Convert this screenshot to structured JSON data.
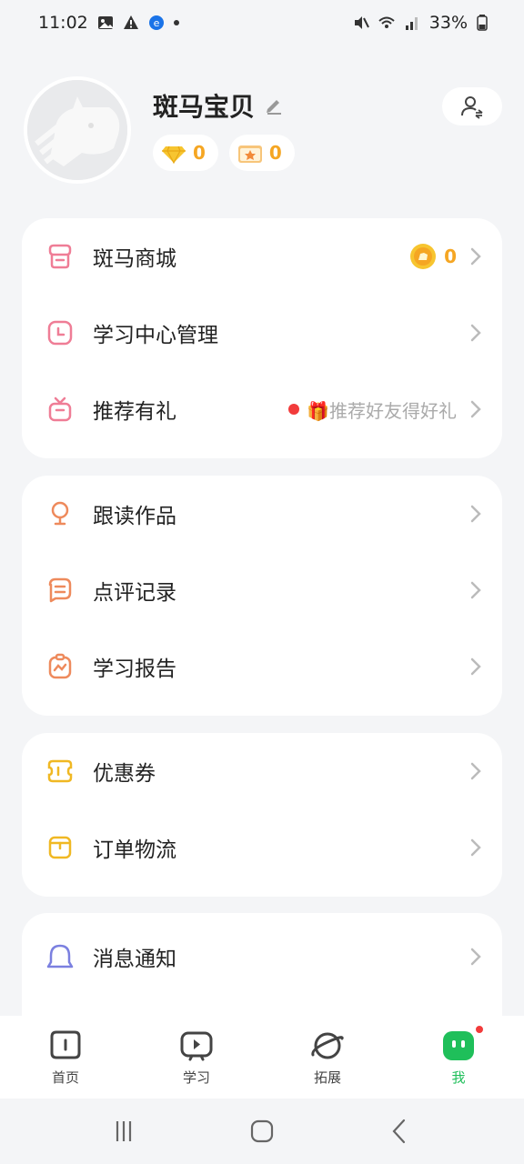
{
  "status_bar": {
    "time": "11:02",
    "battery": "33%"
  },
  "profile": {
    "username": "斑马宝贝",
    "diamonds": "0",
    "gift_count": "0"
  },
  "menu_groups": [
    {
      "items": [
        {
          "label": "斑马商城",
          "icon": "store-icon",
          "extra_count": "0"
        },
        {
          "label": "学习中心管理",
          "icon": "clock-icon"
        },
        {
          "label": "推荐有礼",
          "icon": "gift-box-icon",
          "extra_text": "🎁推荐好友得好礼"
        }
      ]
    },
    {
      "items": [
        {
          "label": "跟读作品",
          "icon": "microphone-icon"
        },
        {
          "label": "点评记录",
          "icon": "comment-icon"
        },
        {
          "label": "学习报告",
          "icon": "report-icon"
        }
      ]
    },
    {
      "items": [
        {
          "label": "优惠券",
          "icon": "coupon-icon"
        },
        {
          "label": "订单物流",
          "icon": "package-icon"
        }
      ]
    },
    {
      "items": [
        {
          "label": "消息通知",
          "icon": "bell-icon"
        }
      ]
    }
  ],
  "bottom_nav": [
    {
      "label": "首页",
      "icon": "home-book-icon"
    },
    {
      "label": "学习",
      "icon": "tv-icon"
    },
    {
      "label": "拓展",
      "icon": "planet-icon"
    },
    {
      "label": "我",
      "icon": "zebra-face-icon",
      "active": true
    }
  ],
  "colors": {
    "pink": "#ef7d96",
    "orange": "#ee8a5c",
    "yellow": "#f0b823",
    "purple": "#7b80e0",
    "green": "#1fbf5a",
    "red_dot": "#f23b3b",
    "coin": "#f5a623"
  }
}
